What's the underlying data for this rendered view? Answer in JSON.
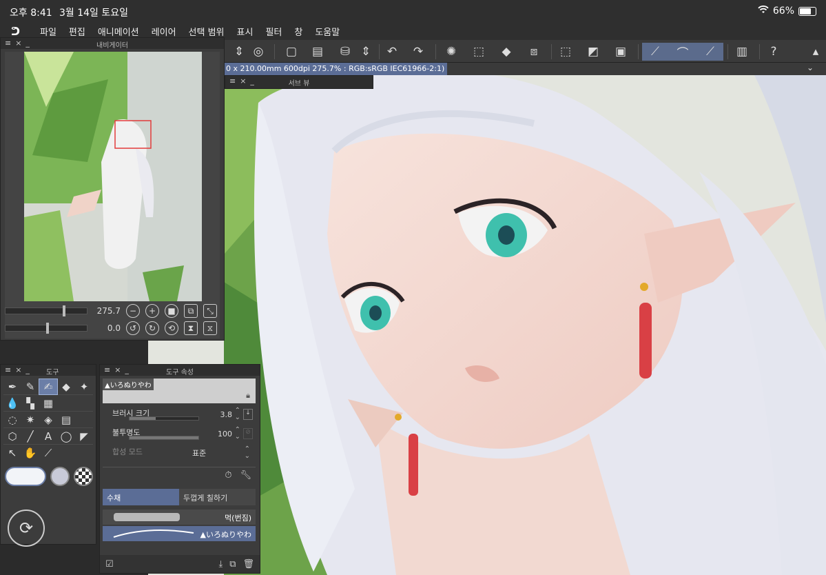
{
  "status": {
    "time": "오후 8:41",
    "date": "3월 14일 토요일",
    "battery": "66%",
    "battery_level": 0.66
  },
  "menu": {
    "logo": "ᕤ",
    "items": [
      "파일",
      "편집",
      "애니메이션",
      "레이어",
      "선택 범위",
      "표시",
      "필터",
      "창",
      "도움말"
    ]
  },
  "canvas": {
    "fileinfo": "0 x 210.00mm 600dpi 275.7% : RGB:sRGB IEC61966-2:1)"
  },
  "navigator": {
    "title": "내비게이터",
    "zoom": "275.7",
    "rotation": "0.0",
    "zoom_level": 0.7,
    "rotation_level": 0.5
  },
  "subview": {
    "title": "서브 뷰"
  },
  "tools": {
    "title": "도구"
  },
  "tool_property": {
    "title": "도구 속성",
    "brush_name": "▲いろぬりやわ",
    "brush_size_label": "브러시 크기",
    "brush_size": "3.8",
    "brush_size_level": 0.38,
    "opacity_label": "불투명도",
    "opacity": "100",
    "opacity_level": 1.0,
    "blend_label": "합성 모드",
    "blend_value": "표준"
  },
  "sub_tool": {
    "tabs": [
      "수채",
      "두껍게 칠하기"
    ],
    "items": [
      "먹(번짐)",
      "▲いろぬりやわ"
    ]
  },
  "colors": {
    "accent": "#5b6d96",
    "panel": "#3c3c3c",
    "background": "#2b2b2b"
  }
}
